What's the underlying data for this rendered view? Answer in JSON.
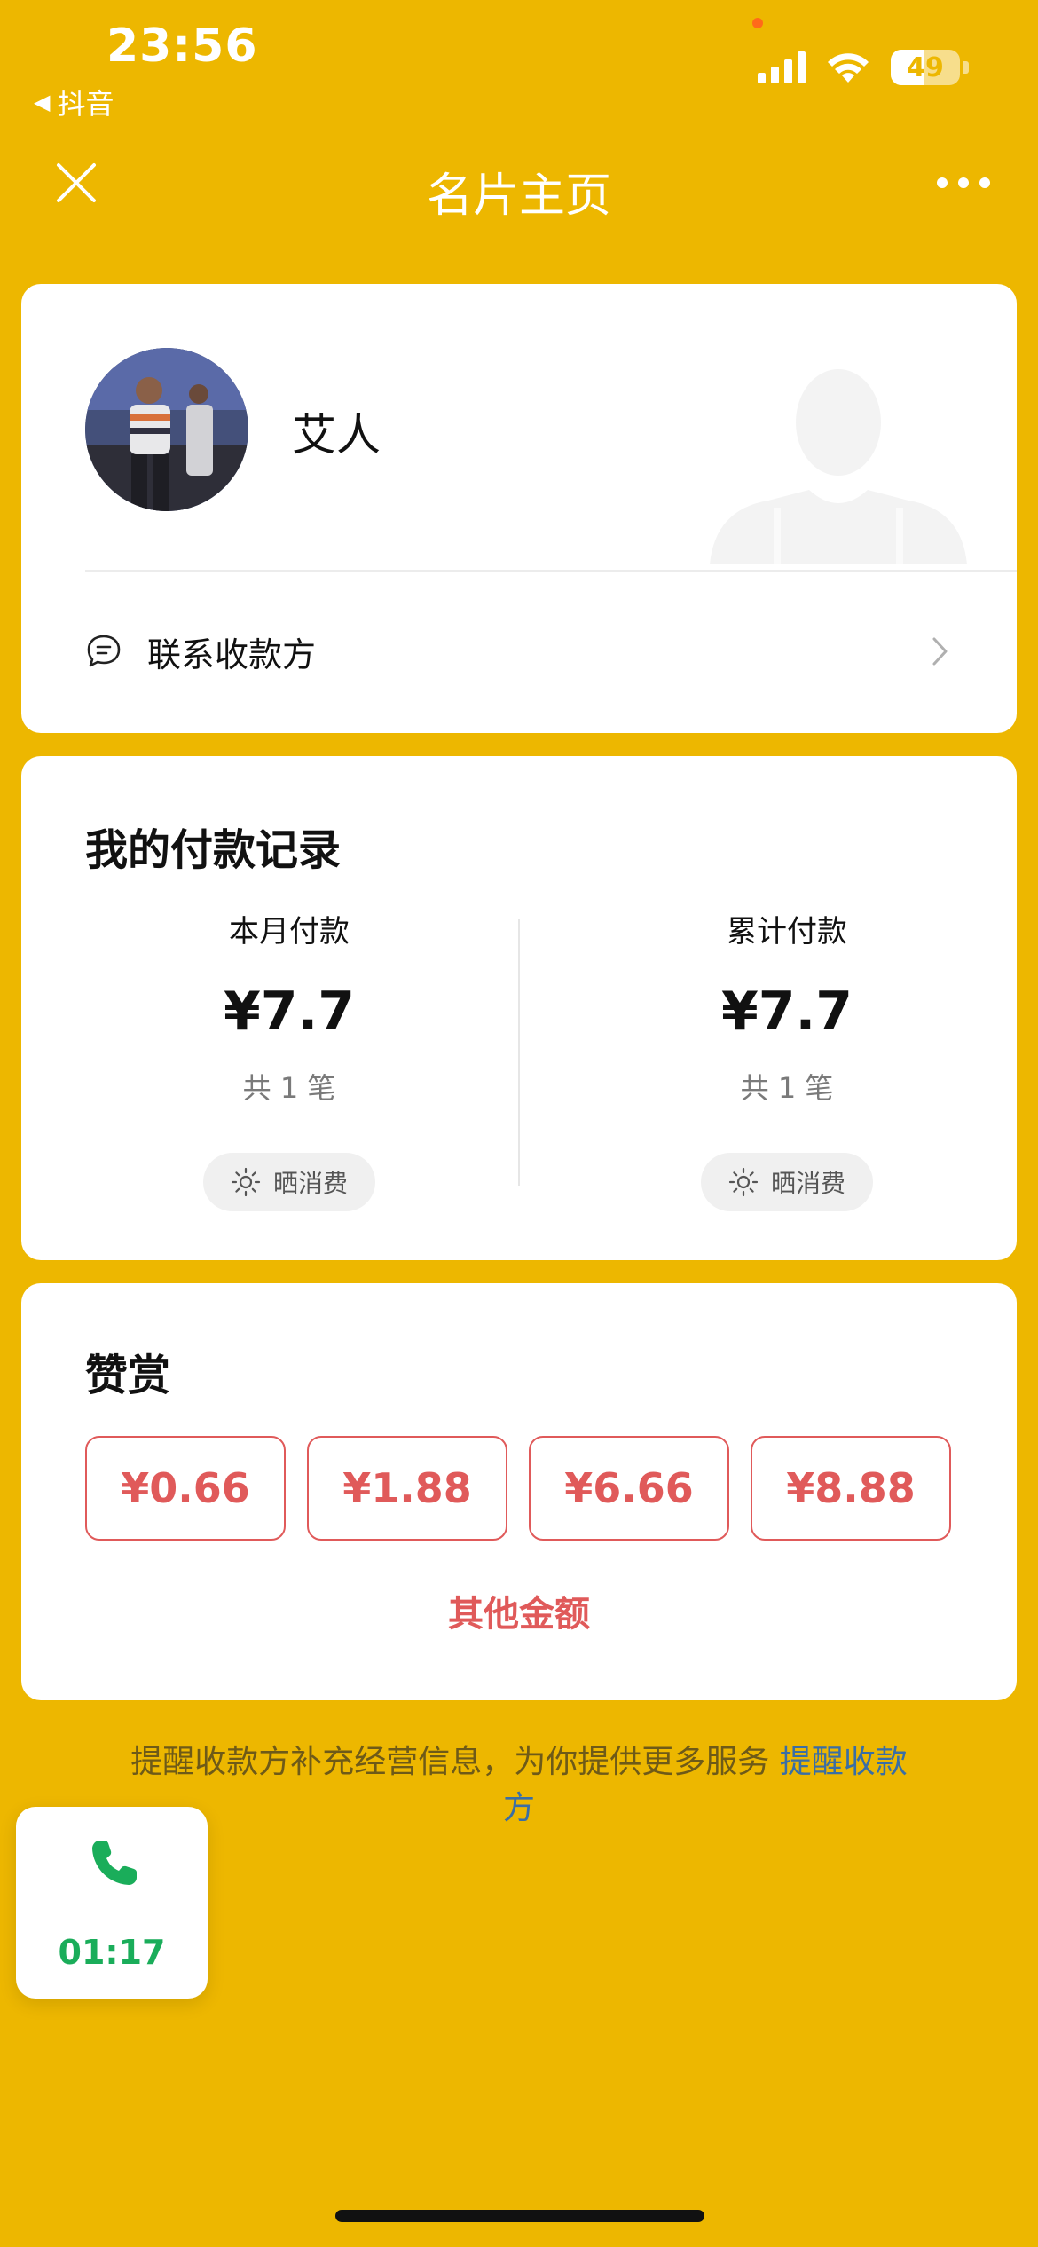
{
  "status_bar": {
    "time": "23:56",
    "back_app": "抖音",
    "battery": "49",
    "battery_level": 0.49
  },
  "nav": {
    "title": "名片主页"
  },
  "profile": {
    "name": "艾人",
    "contact_label": "联系收款方"
  },
  "records": {
    "title": "我的付款记录",
    "month": {
      "label": "本月付款",
      "amount": "¥7.7",
      "count": "共 1 笔",
      "share_label": "晒消费"
    },
    "total": {
      "label": "累计付款",
      "amount": "¥7.7",
      "count": "共 1 笔",
      "share_label": "晒消费"
    }
  },
  "reward": {
    "title": "赞赏",
    "amounts": [
      "¥0.66",
      "¥1.88",
      "¥6.66",
      "¥8.88"
    ],
    "other_label": "其他金额"
  },
  "hint": {
    "text": "提醒收款方补充经营信息，为你提供更多服务 ",
    "link": "提醒收款方"
  },
  "call": {
    "duration": "01:17"
  },
  "colors": {
    "background": "#EDB700",
    "accent_red": "#E05A5A",
    "call_green": "#1AAD5A",
    "link_blue": "#3a6ea5"
  },
  "icons": [
    "close-icon",
    "more-icon",
    "chat-bubble-icon",
    "chevron-right-icon",
    "sun-icon",
    "phone-icon",
    "signal-icon",
    "wifi-icon",
    "battery-icon"
  ]
}
